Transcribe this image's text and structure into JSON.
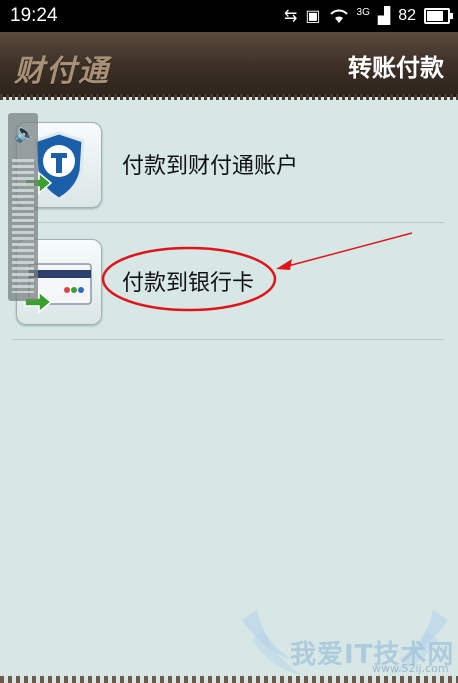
{
  "status": {
    "time": "19:24",
    "signal_label": "3G",
    "battery": "82",
    "battery_level": 0.82
  },
  "header": {
    "logo": "财付通",
    "title": "转账付款"
  },
  "options": [
    {
      "label": "付款到财付通账户",
      "icon": "tenpay-shield-icon"
    },
    {
      "label": "付款到银行卡",
      "icon": "bank-card-icon"
    }
  ],
  "watermark": {
    "text": "我爱IT技术网",
    "site": "www.52ij.com"
  },
  "colors": {
    "background": "#d6e7e6",
    "header": "#3c3026",
    "annotation": "#e3131a",
    "shield": "#1b5fa8",
    "arrow_green": "#3aa02f"
  }
}
